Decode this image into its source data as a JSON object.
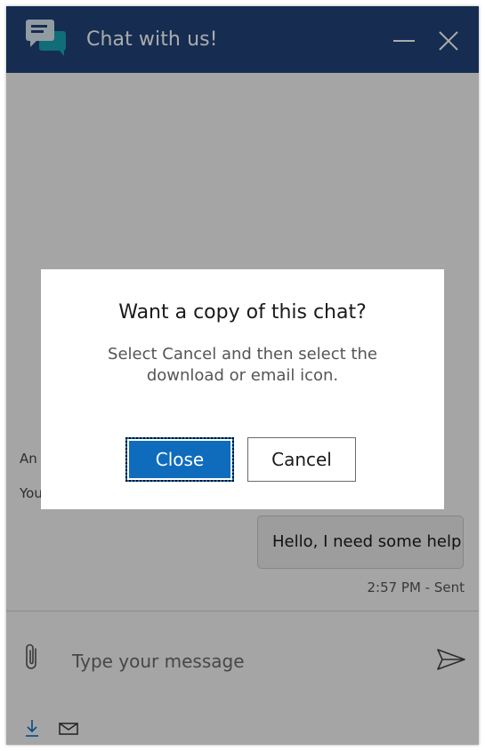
{
  "header": {
    "title": "Chat with us!",
    "color": "#22437a"
  },
  "messages": {
    "system_1": "An",
    "system_2": "You",
    "user_bubble": "Hello, I need some help",
    "timestamp": "2:57 PM - Sent"
  },
  "composer": {
    "placeholder": "Type your message"
  },
  "dialog": {
    "title": "Want a copy of this chat?",
    "text": "Select Cancel and then select the download or email icon.",
    "close_label": "Close",
    "cancel_label": "Cancel"
  },
  "colors": {
    "accent": "#0f6cbd",
    "icon_teal": "#1aa3b3"
  },
  "icons": [
    "chat-bubbles-icon",
    "minimize-icon",
    "close-icon",
    "paperclip-icon",
    "send-icon",
    "download-icon",
    "email-icon"
  ]
}
